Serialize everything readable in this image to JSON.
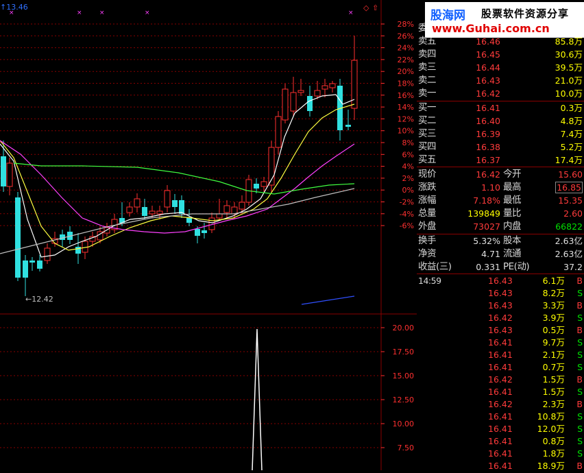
{
  "chart": {
    "top_label": "↑13.46",
    "low_label": "←12.42",
    "price_ticks": [
      "28%",
      "26%",
      "24%",
      "22%",
      "20%",
      "18%",
      "16%",
      "14%",
      "12%",
      "10%",
      "8%",
      "6%",
      "4%",
      "2%",
      "0%",
      "-2%",
      "-4%",
      "-6%"
    ],
    "vol_ticks": [
      "20.00",
      "17.50",
      "15.00",
      "12.50",
      "10.00",
      "7.50"
    ],
    "colors": {
      "up": "#ff3030",
      "down": "#30e0e0",
      "ma5": "#ffffff",
      "ma10": "#ffff40",
      "ma20": "#ff40ff",
      "ma60": "#40ff40",
      "grid": "#8a0000"
    }
  },
  "watermark": {
    "logo": "股海网",
    "slogan": "股票软件资源分享",
    "url": "www.Guhai.com.cn"
  },
  "panel": {
    "weibi_label": "委",
    "asks": [
      {
        "label": "卖五",
        "price": "16.46",
        "vol": "85.8万"
      },
      {
        "label": "卖四",
        "price": "16.45",
        "vol": "30.6万"
      },
      {
        "label": "卖三",
        "price": "16.44",
        "vol": "39.5万"
      },
      {
        "label": "卖二",
        "price": "16.43",
        "vol": "21.0万"
      },
      {
        "label": "卖一",
        "price": "16.42",
        "vol": "10.0万"
      }
    ],
    "bids": [
      {
        "label": "买一",
        "price": "16.41",
        "vol": "0.3万"
      },
      {
        "label": "买二",
        "price": "16.40",
        "vol": "4.8万"
      },
      {
        "label": "买三",
        "price": "16.39",
        "vol": "7.4万"
      },
      {
        "label": "买四",
        "price": "16.38",
        "vol": "5.2万"
      },
      {
        "label": "买五",
        "price": "16.37",
        "vol": "17.4万"
      }
    ],
    "quote": [
      {
        "l1": "现价",
        "v1": "16.42",
        "l2": "今开",
        "v2": "15.60"
      },
      {
        "l1": "涨跌",
        "v1": "1.10",
        "l2": "最高",
        "v2": "16.85"
      },
      {
        "l1": "涨幅",
        "v1": "7.18%",
        "l2": "最低",
        "v2": "15.35"
      },
      {
        "l1": "总量",
        "v1": "139849",
        "l2": "量比",
        "v2": "2.60"
      },
      {
        "l1": "外盘",
        "v1": "73027",
        "l2": "内盘",
        "v2": "66822"
      }
    ],
    "fund": [
      {
        "l1": "换手",
        "v1": "5.32%",
        "l2": "股本",
        "v2": "2.63亿"
      },
      {
        "l1": "净资",
        "v1": "4.71",
        "l2": "流通",
        "v2": "2.63亿"
      },
      {
        "l1": "收益(三)",
        "v1": "0.331",
        "l2": "PE(动)",
        "v2": "37.2"
      }
    ],
    "ticks": [
      {
        "t": "14:59",
        "p": "16.43",
        "v": "6.1万",
        "s": "B"
      },
      {
        "t": "",
        "p": "16.43",
        "v": "8.2万",
        "s": "S"
      },
      {
        "t": "",
        "p": "16.43",
        "v": "3.3万",
        "s": "B"
      },
      {
        "t": "",
        "p": "16.42",
        "v": "3.9万",
        "s": "S"
      },
      {
        "t": "",
        "p": "16.43",
        "v": "0.5万",
        "s": "B"
      },
      {
        "t": "",
        "p": "16.41",
        "v": "9.7万",
        "s": "S"
      },
      {
        "t": "",
        "p": "16.41",
        "v": "2.1万",
        "s": "S"
      },
      {
        "t": "",
        "p": "16.41",
        "v": "0.7万",
        "s": "S"
      },
      {
        "t": "",
        "p": "16.42",
        "v": "1.5万",
        "s": "B"
      },
      {
        "t": "",
        "p": "16.41",
        "v": "1.5万",
        "s": "S"
      },
      {
        "t": "",
        "p": "16.42",
        "v": "2.3万",
        "s": "B"
      },
      {
        "t": "",
        "p": "16.41",
        "v": "10.8万",
        "s": "S"
      },
      {
        "t": "",
        "p": "16.41",
        "v": "12.0万",
        "s": "S"
      },
      {
        "t": "",
        "p": "16.41",
        "v": "0.8万",
        "s": "S"
      },
      {
        "t": "",
        "p": "16.41",
        "v": "1.8万",
        "s": "S"
      },
      {
        "t": "",
        "p": "16.41",
        "v": "18.9万",
        "s": "B"
      }
    ]
  }
}
